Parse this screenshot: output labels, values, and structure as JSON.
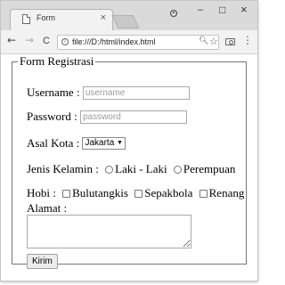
{
  "browser": {
    "tab_title": "Form",
    "tab_close": "×",
    "window_controls": {
      "minimize": "–",
      "maximize": "□",
      "close": "×"
    },
    "nav": {
      "back": "←",
      "forward": "→",
      "reload": "C"
    },
    "url": "file:///D:/html/index.html",
    "icons": [
      "document-icon",
      "info-icon",
      "zoom-icon",
      "star-icon",
      "camera-icon",
      "menu-icon",
      "profile-icon"
    ]
  },
  "form": {
    "legend": "Form Registrasi",
    "username": {
      "label": "Username :",
      "placeholder": "username",
      "value": ""
    },
    "password": {
      "label": "Password :",
      "placeholder": "password",
      "value": ""
    },
    "kota": {
      "label": "Asal Kota :",
      "selected": "Jakarta"
    },
    "gender": {
      "label": "Jenis Kelamin :",
      "options": [
        "Laki - Laki",
        "Perempuan"
      ]
    },
    "hobi": {
      "label": "Hobi :",
      "options": [
        "Bulutangkis",
        "Sepakbola",
        "Renang"
      ]
    },
    "alamat": {
      "label": "Alamat :",
      "value": ""
    },
    "submit_label": "Kirim"
  }
}
